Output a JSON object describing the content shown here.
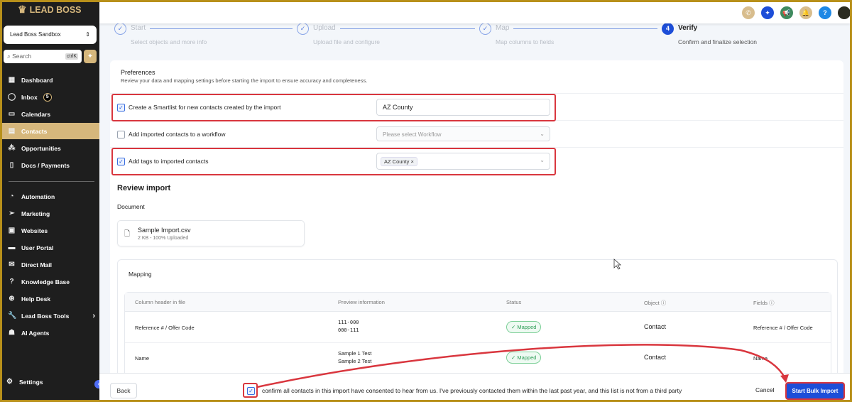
{
  "brand": {
    "name": "LEAD BOSS"
  },
  "sidebar": {
    "account": "Lead Boss Sandbox",
    "search_placeholder": "Search",
    "search_shortcut": "ctrlK",
    "inbox_count": "5",
    "items": [
      {
        "label": "Dashboard",
        "icon": "grid-icon"
      },
      {
        "label": "Inbox",
        "icon": "chat-icon"
      },
      {
        "label": "Calendars",
        "icon": "calendar-icon"
      },
      {
        "label": "Contacts",
        "icon": "contacts-icon"
      },
      {
        "label": "Opportunities",
        "icon": "pipeline-icon"
      },
      {
        "label": "Docs / Payments",
        "icon": "document-icon"
      },
      {
        "label": "Automation",
        "icon": "automation-icon"
      },
      {
        "label": "Marketing",
        "icon": "send-icon"
      },
      {
        "label": "Websites",
        "icon": "website-icon"
      },
      {
        "label": "User Portal",
        "icon": "monitor-icon"
      },
      {
        "label": "Direct Mail",
        "icon": "mail-icon"
      },
      {
        "label": "Knowledge Base",
        "icon": "help-icon"
      },
      {
        "label": "Help Desk",
        "icon": "lifebuoy-icon"
      },
      {
        "label": "Lead Boss Tools",
        "icon": "wrench-icon"
      },
      {
        "label": "AI Agents",
        "icon": "robot-icon"
      }
    ],
    "settings": "Settings"
  },
  "steps": [
    {
      "title": "Start",
      "subtitle": "Select objects and more info",
      "num": "✓"
    },
    {
      "title": "Upload",
      "subtitle": "Upload file and configure",
      "num": "✓"
    },
    {
      "title": "Map",
      "subtitle": "Map columns to fields",
      "num": "✓"
    },
    {
      "title": "Verify",
      "subtitle": "Confirm and finalize selection",
      "num": "4"
    }
  ],
  "preferences": {
    "title": "Preferences",
    "description": "Review your data and mapping settings before starting the import to ensure accuracy and completeness.",
    "smartlist_label": "Create a Smartlist for new contacts created by the import",
    "smartlist_value": "AZ County",
    "workflow_label": "Add imported contacts to a workflow",
    "workflow_placeholder": "Please select Workflow",
    "tags_label": "Add tags to imported contacts",
    "tag": "AZ County"
  },
  "review": {
    "title": "Review import",
    "document_label": "Document",
    "file_name": "Sample Import.csv",
    "file_meta": "2 KB - 100% Uploaded"
  },
  "mapping": {
    "title": "Mapping",
    "headers": [
      "Column header in file",
      "Preview information",
      "Status",
      "Object",
      "Fields"
    ],
    "rows": [
      {
        "column": "Reference # / Offer Code",
        "preview1": "111-000",
        "preview2": "000-111",
        "status": "Mapped",
        "object": "Contact",
        "field": "Reference # / Offer Code"
      },
      {
        "column": "Name",
        "preview1": "Sample 1 Test",
        "preview2": "Sample 2 Test",
        "status": "Mapped",
        "object": "Contact",
        "field": "Name"
      }
    ]
  },
  "footer": {
    "back": "Back",
    "consent": "confirm all contacts in this import have consented to hear from us. I've previously contacted them within the last past year, and this list is not from a third party",
    "cancel": "Cancel",
    "start": "Start Bulk Import"
  },
  "colors": {
    "accent": "#1d4ed8",
    "brand": "#d6b77c",
    "annotation": "#d9363e"
  }
}
